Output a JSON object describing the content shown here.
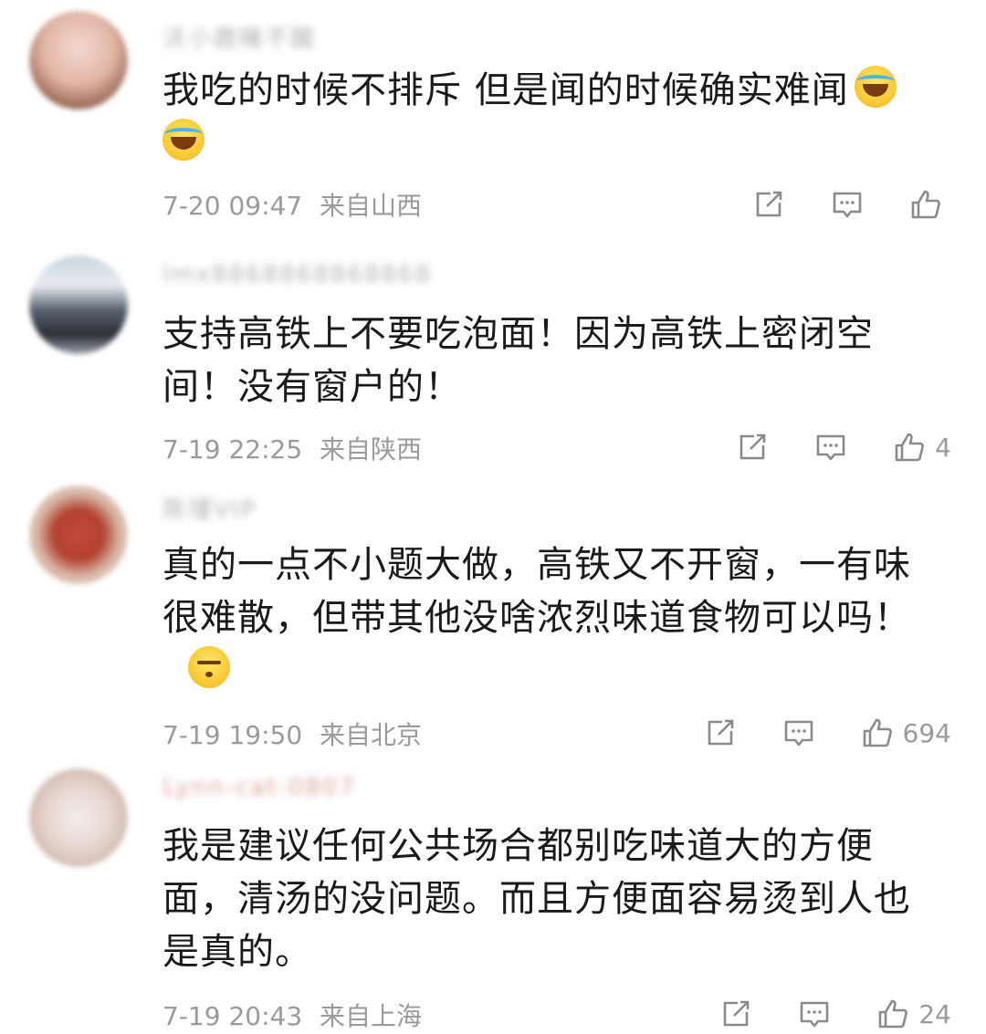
{
  "comments": [
    {
      "username": "沃小鹿睡不醒",
      "text": "我吃的时候不排斥 但是闻的时候确实难闻",
      "emojis": [
        "laugh-cry-icon",
        "laugh-cry-icon"
      ],
      "time": "7-20 09:47",
      "location": "来自山西",
      "likes": ""
    },
    {
      "username": "lmx8868868868868",
      "text": "支持高铁上不要吃泡面！因为高铁上密闭空间！没有窗户的！",
      "emojis": [],
      "time": "7-19 22:25",
      "location": "来自陕西",
      "likes": "4"
    },
    {
      "username": "陈瑾VIP",
      "text": "真的一点不小题大做，高铁又不开窗，一有味很难散，但带其他没啥浓烈味道食物可以吗！",
      "emojis": [
        "awkward-icon"
      ],
      "time": "7-19 19:50",
      "location": "来自北京",
      "likes": "694"
    },
    {
      "username": "Lynn-cat-0807",
      "text": "我是建议任何公共场合都别吃味道大的方便面，清汤的没问题。而且方便面容易烫到人也是真的。",
      "emojis": [],
      "time": "7-19 20:43",
      "location": "来自上海",
      "likes": "24"
    }
  ],
  "colors": {
    "text": "#1a1a1a",
    "meta": "#9a9a9a",
    "username": "#b5b5b5"
  }
}
